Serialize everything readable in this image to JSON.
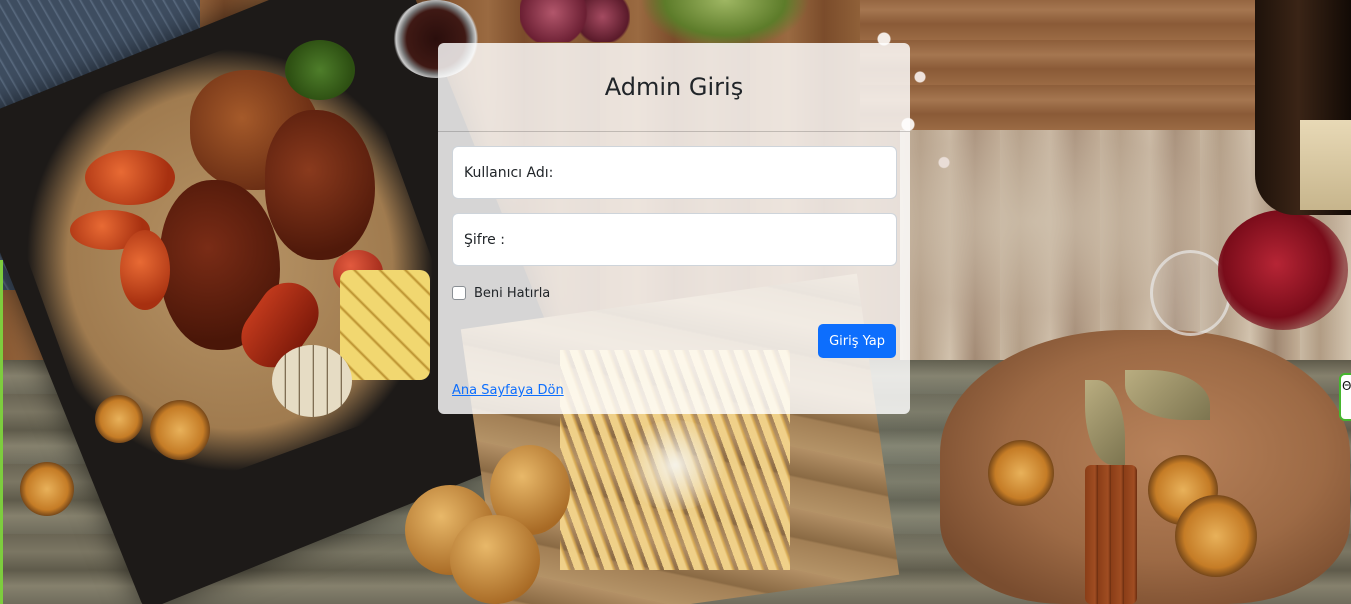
{
  "login": {
    "title": "Admin Giriş",
    "username_placeholder": "Kullanıcı Adı:",
    "password_placeholder": "Şifre :",
    "remember_label": "Beni Hatırla",
    "remember_checked": false,
    "submit_label": "Giriş Yap",
    "back_link": "Ana Sayfaya Dön"
  },
  "side_badge": {
    "text": "Θ"
  },
  "colors": {
    "primary": "#0d6efd",
    "card_bg": "rgba(255,255,255,0.82)",
    "side_badge_border": "#45b62e"
  },
  "background": {
    "description_icon": "food-table-photo"
  }
}
